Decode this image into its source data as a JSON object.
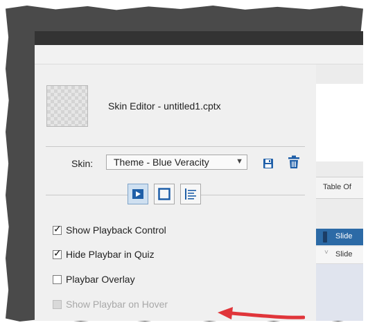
{
  "editor": {
    "title": "Skin Editor - untitled1.cptx"
  },
  "skin": {
    "label": "Skin:",
    "selected": "Theme - Blue Veracity"
  },
  "tabs": [
    {
      "icon": "playback-icon",
      "active": true
    },
    {
      "icon": "border-icon",
      "active": false
    },
    {
      "icon": "toc-icon",
      "active": false
    }
  ],
  "options": [
    {
      "label": "Show Playback Control",
      "checked": true,
      "enabled": true
    },
    {
      "label": "Hide Playbar in Quiz",
      "checked": true,
      "enabled": true
    },
    {
      "label": "Playbar Overlay",
      "checked": false,
      "enabled": true
    },
    {
      "label": "Show Playbar on Hover",
      "checked": false,
      "enabled": false
    }
  ],
  "right_panel": {
    "header": "Table Of",
    "slide1": "Slide",
    "slide2": "Slide"
  },
  "colors": {
    "accent": "#1f5fa8",
    "annotation_arrow": "#e0353a"
  }
}
